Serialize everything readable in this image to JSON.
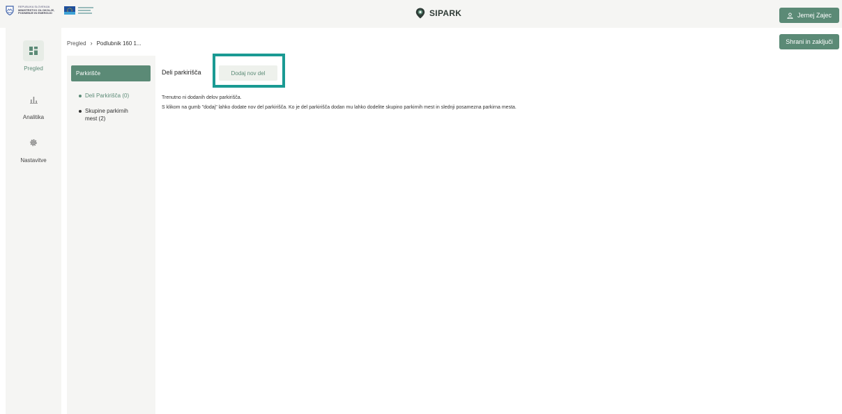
{
  "header": {
    "gov_logo_lines": [
      "REPUBLIKA SLOVENIJA",
      "MINISTRSTVO ZA OKOLJE,",
      "PODNEBJE IN ENERGIJO"
    ],
    "brand_name": "SIPARK",
    "user_name": "Jernej Zajec",
    "save_label": "Shrani in zaključi"
  },
  "sidebar": {
    "items": [
      {
        "label": "Pregled",
        "icon": "dashboard-icon",
        "active": true
      },
      {
        "label": "Analitika",
        "icon": "bar-chart-icon",
        "active": false
      },
      {
        "label": "Nastavitve",
        "icon": "gear-icon",
        "active": false
      }
    ]
  },
  "breadcrumb": {
    "root": "Pregled",
    "current": "Podlubnik 160 1..."
  },
  "sub_panel": {
    "header": "Parkirišče",
    "items": [
      {
        "label": "Deli Parkirišča (0)",
        "active": true
      },
      {
        "label_line1": "Skupine parkirnih",
        "label_line2": "mest (2)",
        "active": false
      }
    ]
  },
  "content": {
    "title": "Deli parkirišča",
    "add_button": "Dodaj nov del",
    "message_1": "Trenutno ni dodanih delov parkirišča.",
    "message_2": "S klikom na gumb \"dodaj\" lahko dodate nov del parkirišča. Ko je del parkirišča dodan mu lahko dodelite skupino parkirnih mest in slednji posamezna parkirna mesta."
  },
  "colors": {
    "accent": "#5b8a76",
    "highlight_frame": "#1a9a93",
    "panel_bg": "#f5f5f3"
  }
}
